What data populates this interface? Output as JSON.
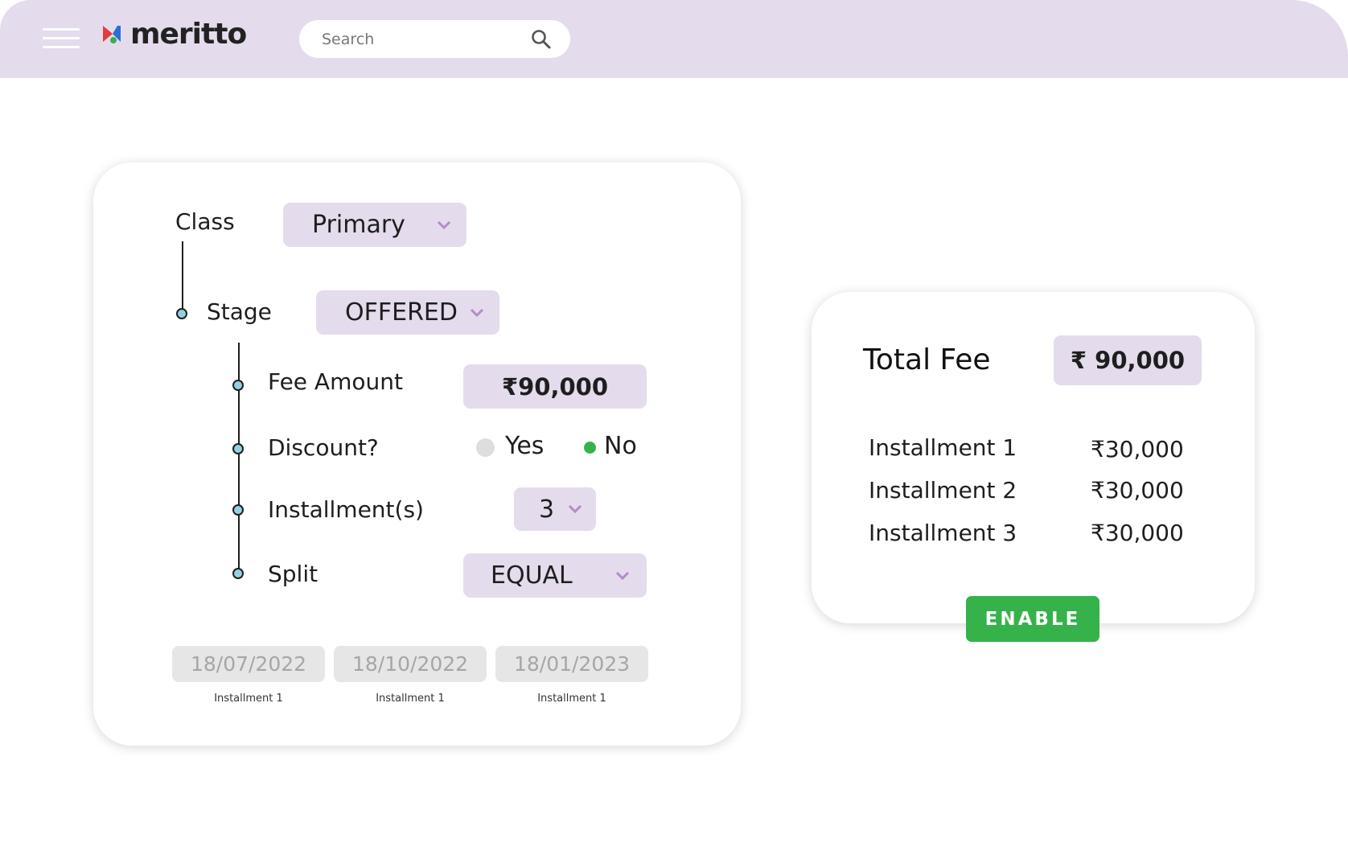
{
  "header": {
    "brand": "meritto",
    "search_placeholder": "Search"
  },
  "form": {
    "class_label": "Class",
    "class_value": "Primary",
    "stage_label": "Stage",
    "stage_value": "OFFERED",
    "fee_amount_label": "Fee Amount",
    "fee_amount_value": "₹90,000",
    "discount_label": "Discount?",
    "discount_options": [
      "Yes",
      "No"
    ],
    "discount_selected": "No",
    "installments_label": "Installment(s)",
    "installments_value": "3",
    "split_label": "Split",
    "split_value": "EQUAL",
    "dates": [
      {
        "date": "18/07/2022",
        "caption": "Installment 1"
      },
      {
        "date": "18/10/2022",
        "caption": "Installment 1"
      },
      {
        "date": "18/01/2023",
        "caption": "Installment 1"
      }
    ]
  },
  "summary": {
    "total_label": "Total Fee",
    "total_value": "₹ 90,000",
    "installments": [
      {
        "label": "Installment 1",
        "amount": "₹30,000"
      },
      {
        "label": "Installment 2",
        "amount": "₹30,000"
      },
      {
        "label": "Installment 3",
        "amount": "₹30,000"
      }
    ],
    "enable_label": "ENABLE"
  },
  "colors": {
    "brand_lavender": "#e4dbec",
    "accent_green": "#36b24a",
    "node_teal": "#8fd3df"
  }
}
